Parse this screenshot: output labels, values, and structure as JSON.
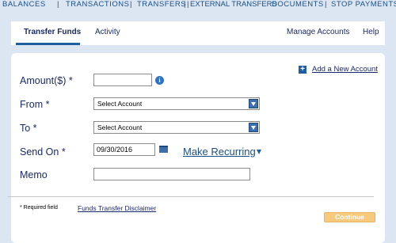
{
  "top_nav": {
    "balances": "BALANCES",
    "transactions": "TRANSACTIONS",
    "transfers": "TRANSFERS",
    "external_transfers": "EXTERNAL TRANSFERS",
    "documents": "DOCUMENTS",
    "stop_payments": "STOP PAYMENTS"
  },
  "tabs": {
    "transfer_funds": "Transfer Funds",
    "activity": "Activity",
    "manage_accounts": "Manage Accounts",
    "help": "Help"
  },
  "form": {
    "add_account_label": "Add a New Account",
    "amount_label": "Amount($) *",
    "amount_value": "",
    "from_label": "From *",
    "from_selected": "Select Account",
    "to_label": "To *",
    "to_selected": "Select Account",
    "send_on_label": "Send On *",
    "send_on_value": "09/30/2016",
    "make_recurring_label": "Make Recurring",
    "memo_label": "Memo",
    "memo_value": ""
  },
  "footer": {
    "required_note": "* Required field",
    "disclaimer_link": "Funds Transfer Disclaimer",
    "continue_label": "Continue"
  },
  "icons": {
    "info": "info-icon",
    "add": "plus-icon",
    "calendar": "calendar-icon",
    "dropdown": "chevron-down-icon"
  },
  "colors": {
    "background": "#dbe6f2",
    "primary_text": "#1a2a6c",
    "accent_blue": "#1f5f9e",
    "continue_button": "#f6c97c"
  }
}
